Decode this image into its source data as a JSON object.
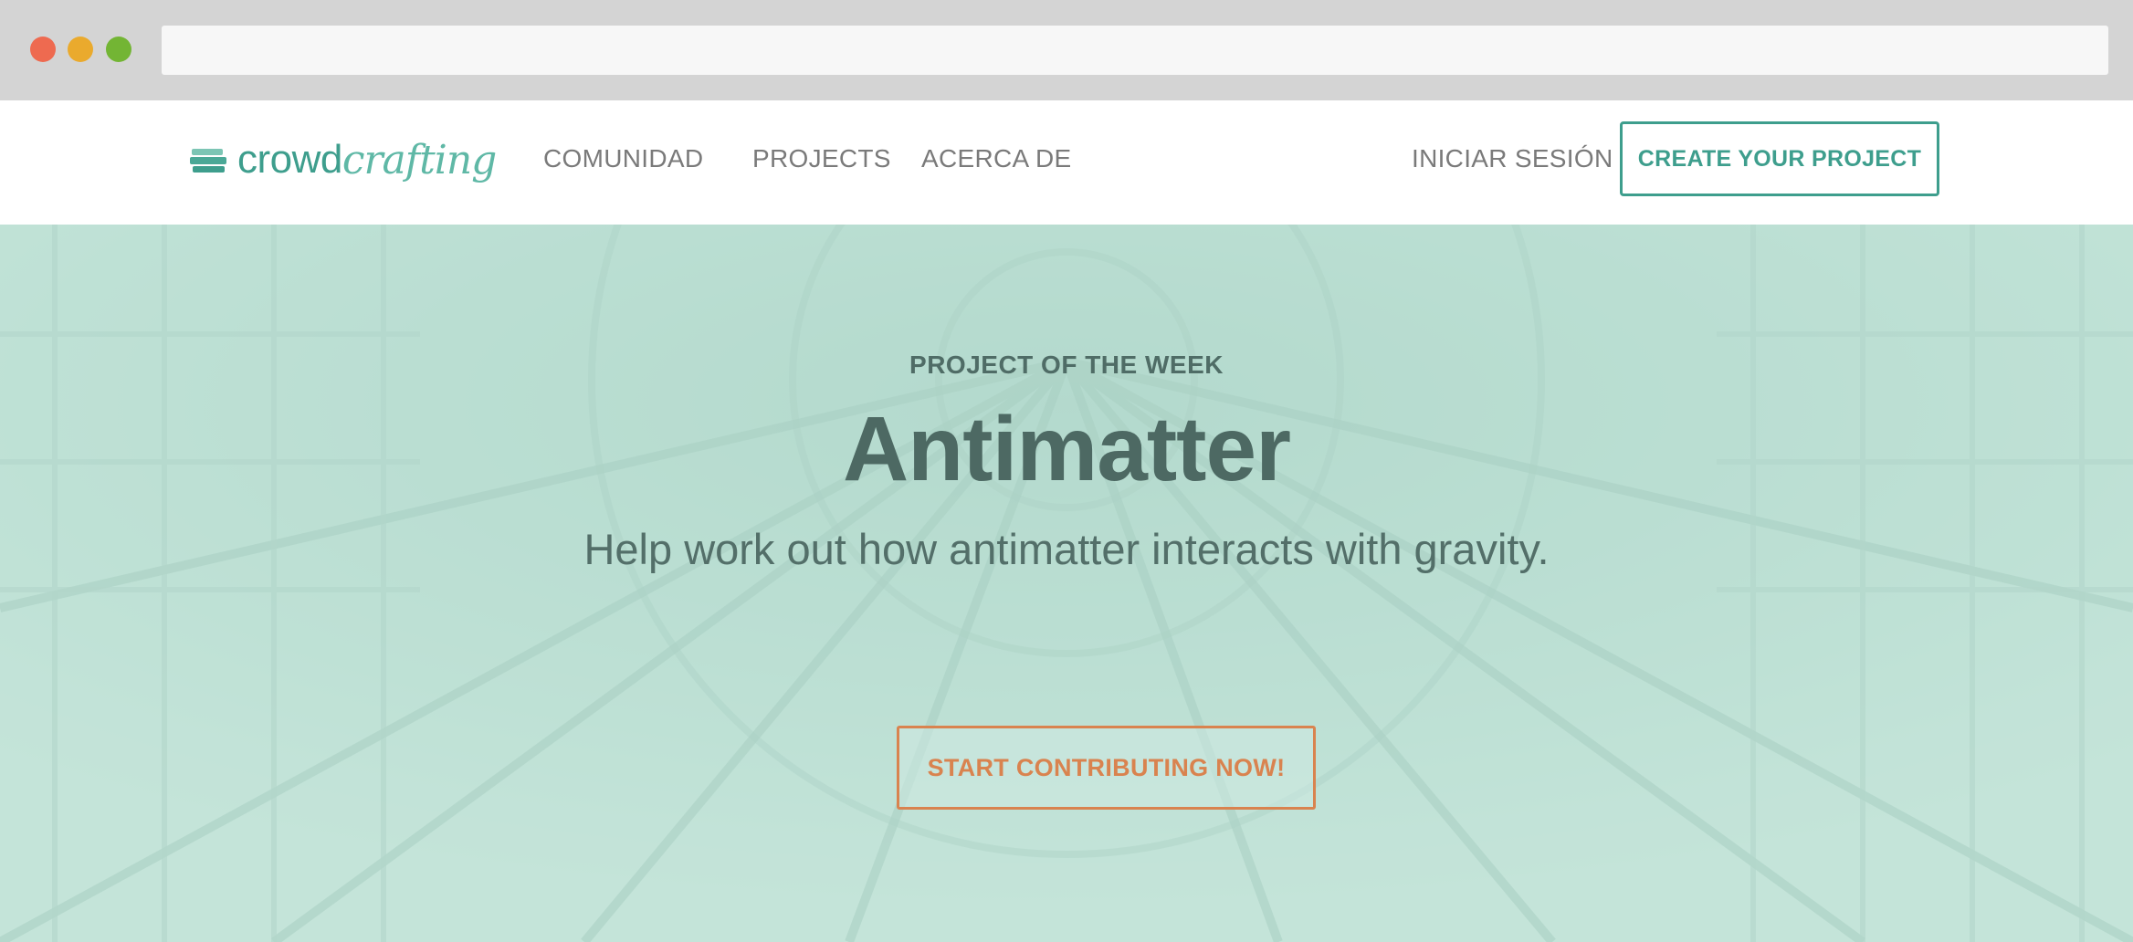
{
  "browser": {
    "address_value": ""
  },
  "navbar": {
    "logo": {
      "part_a": "crowd",
      "part_b": "crafting"
    },
    "links": [
      {
        "label": "COMUNIDAD"
      },
      {
        "label": "PROJECTS"
      },
      {
        "label": "ACERCA DE"
      }
    ],
    "login_label": "INICIAR SESIÓN",
    "create_label": "CREATE YOUR PROJECT"
  },
  "hero": {
    "eyebrow": "PROJECT OF THE WEEK",
    "title": "Antimatter",
    "subtitle": "Help work out how antimatter interacts with gravity.",
    "cta_label": "START CONTRIBUTING NOW!"
  },
  "colors": {
    "brand": "#3e9e8d",
    "cta": "#d9834f",
    "hero_tint": "#b9ddd1",
    "hero_text": "#4d6963"
  }
}
